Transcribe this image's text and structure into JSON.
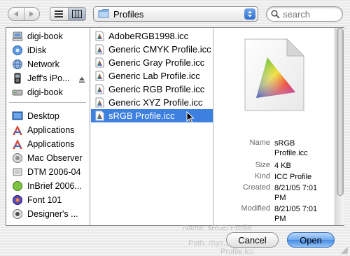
{
  "toolbar": {
    "path": "Profiles",
    "search_placeholder": "search"
  },
  "sidebar": {
    "devices": [
      {
        "label": "digi-book",
        "icon": "computer-icon"
      },
      {
        "label": "iDisk",
        "icon": "idisk-icon"
      },
      {
        "label": "Network",
        "icon": "network-icon"
      },
      {
        "label": "Jeff's iPo...",
        "icon": "ipod-icon"
      },
      {
        "label": "digi-book",
        "icon": "hard-drive-icon"
      }
    ],
    "places": [
      {
        "label": "Desktop",
        "icon": "desktop-icon"
      },
      {
        "label": "Applications",
        "icon": "applications-icon"
      },
      {
        "label": "Applications",
        "icon": "applications-icon"
      },
      {
        "label": "Mac Observer",
        "icon": "folder-icon"
      },
      {
        "label": "DTM 2006-04",
        "icon": "disk-image-icon"
      },
      {
        "label": "InBrief 2006...",
        "icon": "document-icon"
      },
      {
        "label": "Font 101",
        "icon": "document-icon"
      },
      {
        "label": "Designer's ...",
        "icon": "document-icon"
      }
    ]
  },
  "files": [
    {
      "name": "AdobeRGB1998.icc",
      "selected": false
    },
    {
      "name": "Generic CMYK Profile.icc",
      "selected": false
    },
    {
      "name": "Generic Gray Profile.icc",
      "selected": false
    },
    {
      "name": "Generic Lab Profile.icc",
      "selected": false
    },
    {
      "name": "Generic RGB Profile.icc",
      "selected": false
    },
    {
      "name": "Generic XYZ Profile.icc",
      "selected": false
    },
    {
      "name": "sRGB Profile.icc",
      "selected": true
    }
  ],
  "preview": {
    "rows": [
      {
        "key": "Name",
        "value": "sRGB Profile.icc"
      },
      {
        "key": "Size",
        "value": "4 KB"
      },
      {
        "key": "Kind",
        "value": "ICC Profile"
      },
      {
        "key": "Created",
        "value": "8/21/05 7:01 PM"
      },
      {
        "key": "Modified",
        "value": "8/21/05 7:01 PM"
      }
    ]
  },
  "background_text": {
    "name_line": "Name: sRGB Profile",
    "path_line": "Path: /Sys...",
    "profile_line": "Profile.icc"
  },
  "buttons": {
    "cancel": "Cancel",
    "open": "Open"
  },
  "colors": {
    "selection": "#3d80df",
    "default_button": "#4a8ae3"
  }
}
